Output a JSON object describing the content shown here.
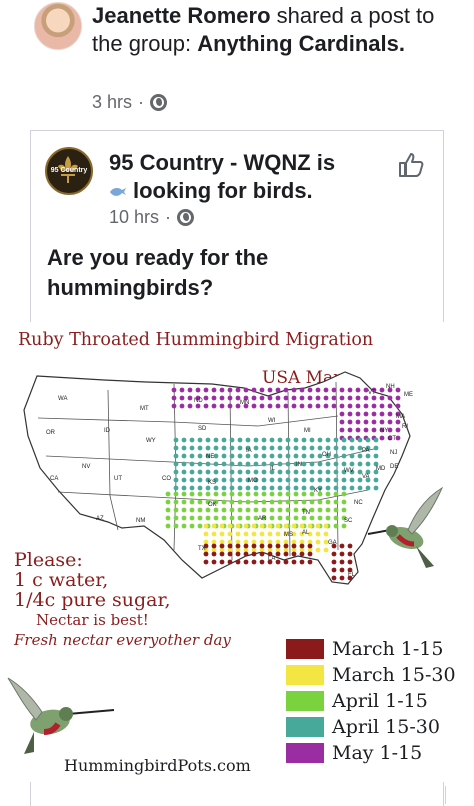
{
  "post": {
    "author": "Jeanette Romero",
    "shared_mid": " shared a post to the group: ",
    "group": "Anything Cardinals.",
    "timestamp": "3 hrs",
    "separator": "·",
    "privacy_icon": "globe-icon"
  },
  "shared_post": {
    "page_name": "95 Country - WQNZ",
    "status_mid": " is ",
    "status_text": "looking for birds.",
    "status_icon": "bird-icon",
    "timestamp": "10 hrs",
    "separator": "·",
    "privacy_icon": "globe-icon",
    "avatar_text": "95 Country",
    "body": "Are you ready for the hummingbirds?",
    "like_icon": "thumbs-up-icon"
  },
  "infographic": {
    "title": "Ruby Throated Hummingbird Migration",
    "subtitle": "USA Map",
    "state_labels": [
      "WA",
      "OR",
      "CA",
      "NV",
      "ID",
      "MT",
      "WY",
      "UT",
      "CO",
      "AZ",
      "NM",
      "ND",
      "SD",
      "NE",
      "KS",
      "OK",
      "TX",
      "MN",
      "IA",
      "MO",
      "AR",
      "LA",
      "WI",
      "IL",
      "MS",
      "AL",
      "MI",
      "IN",
      "OH",
      "KY",
      "TN",
      "GA",
      "FL",
      "SC",
      "NC",
      "VA",
      "WV",
      "PA",
      "NY",
      "VT",
      "NH",
      "ME",
      "MA",
      "RI",
      "CT",
      "NJ",
      "DE",
      "MD"
    ],
    "note": [
      "Please:",
      "1 c water,",
      "1/4c pure sugar,",
      "Nectar is best!",
      "Fresh nectar everyother day"
    ],
    "legend": [
      {
        "label": "March 1-15",
        "color": "#8b1a1a"
      },
      {
        "label": "March 15-30",
        "color": "#f4e642"
      },
      {
        "label": "April 1-15",
        "color": "#7ad23e"
      },
      {
        "label": "April 15-30",
        "color": "#46a99a"
      },
      {
        "label": "May 1-15",
        "color": "#9b2da3"
      }
    ],
    "website": "HummingbirdPots.com"
  }
}
